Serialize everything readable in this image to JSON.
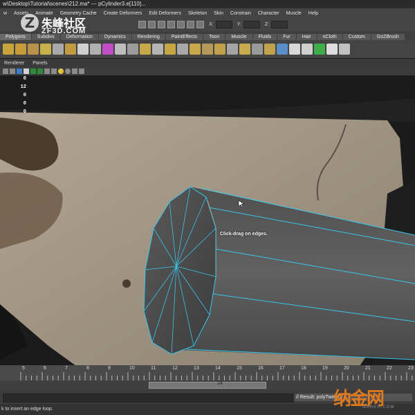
{
  "window": {
    "title": "w\\Desktop\\Tutorial\\scenes\\212.ma*  ---  pCylinder3.e[110]..."
  },
  "menubar": {
    "items": [
      "w",
      "Assets",
      "Animate",
      "Geometry Cache",
      "Create Deformers",
      "Edit Deformers",
      "Skeleton",
      "Skin",
      "Constrain",
      "Character",
      "Muscle",
      "Help"
    ],
    "coord_labels": [
      "X:",
      "Y:",
      "Z:"
    ]
  },
  "watermark_top": {
    "logo": "Z",
    "cn": "朱峰社区",
    "en": "ZF3D.COM"
  },
  "shelf": {
    "tabs": [
      "Polygons",
      "Subdivs",
      "Deformation",
      "Dynamics",
      "Rendering",
      "PaintEffects",
      "Toon",
      "Muscle",
      "Fluids",
      "Fur",
      "Hair",
      "nCloth",
      "Custom",
      "GoZBrush"
    ],
    "active_tab": 0
  },
  "panel_menu": {
    "items": [
      "Renderer",
      "Panels"
    ]
  },
  "hud": {
    "values": [
      "0",
      "12",
      "0",
      "0",
      "0"
    ]
  },
  "viewport": {
    "tooltip": "Click-drag on edges."
  },
  "timeline": {
    "ticks": [
      "5",
      "6",
      "7",
      "8",
      "9",
      "10",
      "11",
      "12",
      "13",
      "14",
      "15",
      "16",
      "17",
      "18",
      "19",
      "20",
      "21",
      "22",
      "23",
      "24"
    ],
    "range_end": "24"
  },
  "command": {
    "result": "// Result: polyTweak3"
  },
  "helpline": {
    "text": "k to insert an edge loop."
  },
  "watermark_bottom": {
    "cn": "纳金网",
    "en": "NARKII.COM"
  },
  "colors": {
    "accent_edge": "#39c6ee",
    "selection_edge": "#e57a2a",
    "shelf_bg": "#444444",
    "viewport_bg": "#181818"
  }
}
